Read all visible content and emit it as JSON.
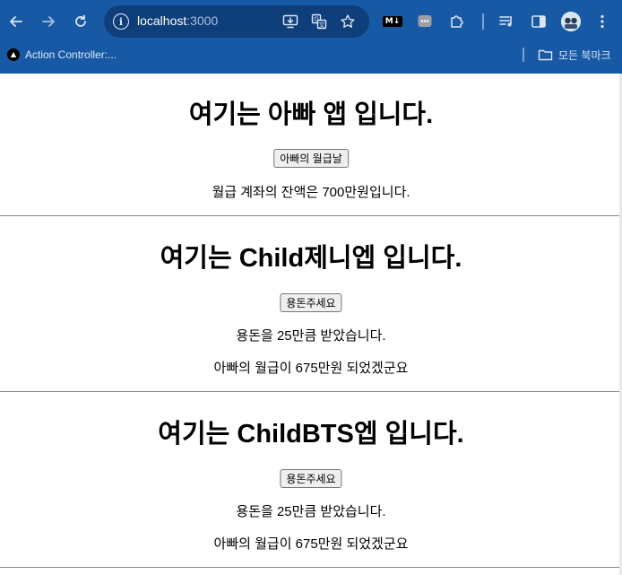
{
  "browser": {
    "url_host": "localhost",
    "url_port": ":3000",
    "bookmark_item": "Action Controller:...",
    "bookmarks_folder": "모든 북마크",
    "extension_badge": "M↓",
    "accent": "#1859a6"
  },
  "sections": [
    {
      "title": "여기는 아빠 앱 입니다.",
      "button": "아빠의 월급날",
      "lines": [
        "월급 계좌의 잔액은 700만원입니다."
      ]
    },
    {
      "title": "여기는 Child제니엡 입니다.",
      "button": "용돈주세요",
      "lines": [
        "용돈을 25만큼 받았습니다.",
        "아빠의 월급이 675만원 되었겠군요"
      ]
    },
    {
      "title": "여기는 ChildBTS엡 입니다.",
      "button": "용돈주세요",
      "lines": [
        "용돈을 25만큼 받았습니다.",
        "아빠의 월급이 675만원 되었겠군요"
      ]
    }
  ]
}
